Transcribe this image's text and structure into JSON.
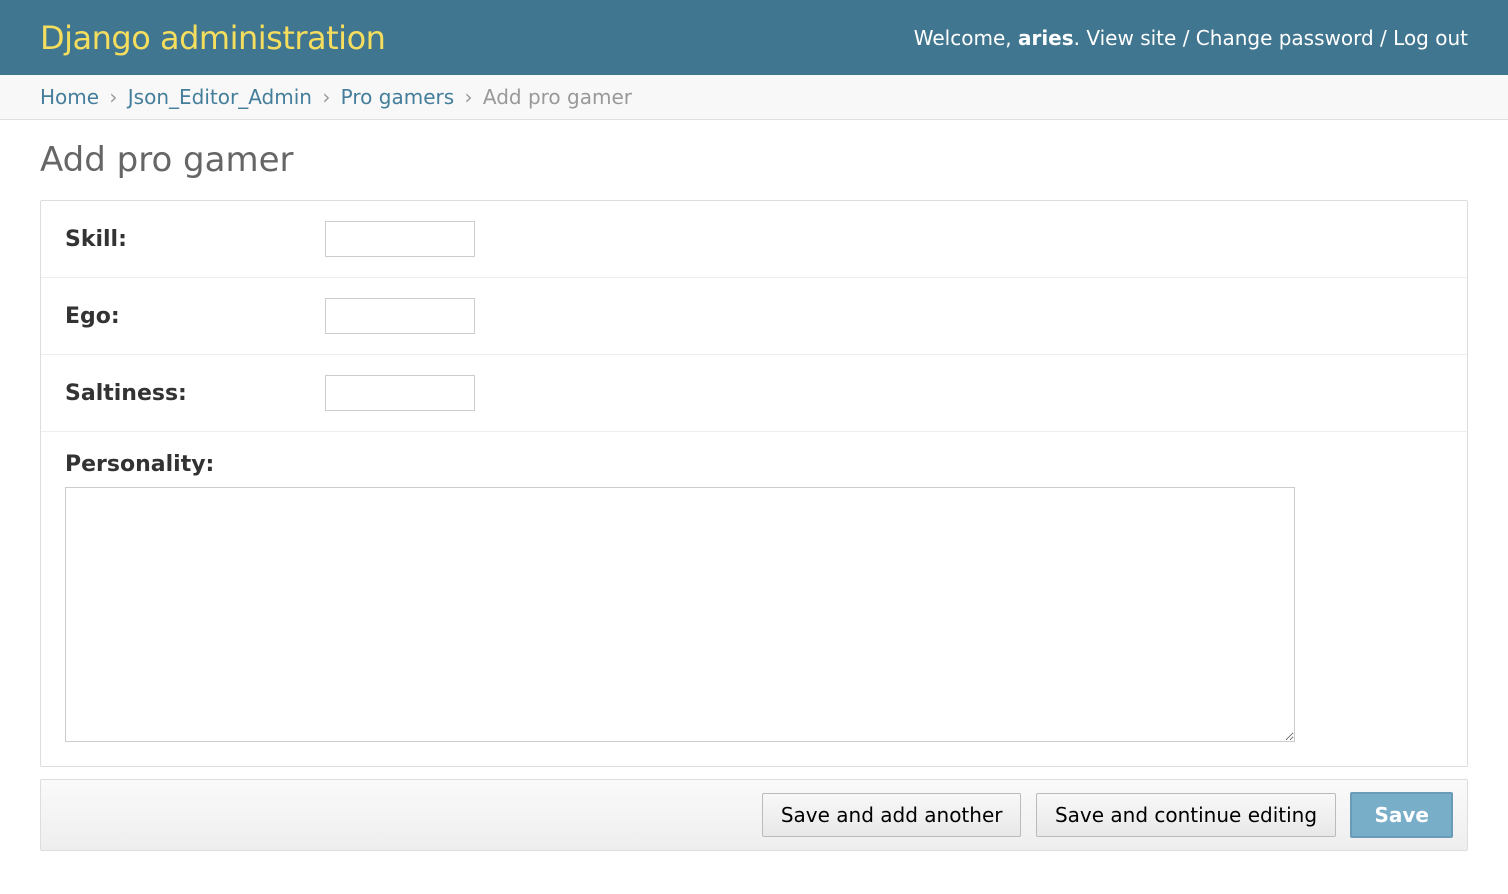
{
  "branding": {
    "title": "Django administration"
  },
  "user_tools": {
    "welcome": "Welcome,",
    "username": "aries",
    "period": ".",
    "view_site": "View site",
    "change_password": "Change password",
    "log_out": "Log out",
    "sep": "/"
  },
  "breadcrumbs": {
    "home": "Home",
    "app": "Json_Editor_Admin",
    "model": "Pro gamers",
    "current": "Add pro gamer",
    "sep": "›"
  },
  "page": {
    "title": "Add pro gamer"
  },
  "form": {
    "fields": {
      "skill": {
        "label": "Skill:",
        "value": ""
      },
      "ego": {
        "label": "Ego:",
        "value": ""
      },
      "saltiness": {
        "label": "Saltiness:",
        "value": ""
      },
      "personality": {
        "label": "Personality:",
        "value": ""
      }
    },
    "buttons": {
      "save_add_another": "Save and add another",
      "save_continue": "Save and continue editing",
      "save": "Save"
    }
  }
}
